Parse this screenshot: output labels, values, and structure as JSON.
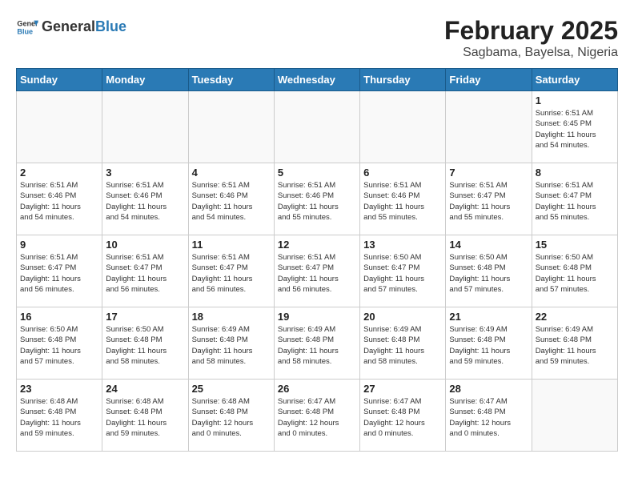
{
  "header": {
    "logo_general": "General",
    "logo_blue": "Blue",
    "title": "February 2025",
    "subtitle": "Sagbama, Bayelsa, Nigeria"
  },
  "calendar": {
    "days_of_week": [
      "Sunday",
      "Monday",
      "Tuesday",
      "Wednesday",
      "Thursday",
      "Friday",
      "Saturday"
    ],
    "weeks": [
      [
        {
          "day": "",
          "info": ""
        },
        {
          "day": "",
          "info": ""
        },
        {
          "day": "",
          "info": ""
        },
        {
          "day": "",
          "info": ""
        },
        {
          "day": "",
          "info": ""
        },
        {
          "day": "",
          "info": ""
        },
        {
          "day": "1",
          "info": "Sunrise: 6:51 AM\nSunset: 6:45 PM\nDaylight: 11 hours\nand 54 minutes."
        }
      ],
      [
        {
          "day": "2",
          "info": "Sunrise: 6:51 AM\nSunset: 6:46 PM\nDaylight: 11 hours\nand 54 minutes."
        },
        {
          "day": "3",
          "info": "Sunrise: 6:51 AM\nSunset: 6:46 PM\nDaylight: 11 hours\nand 54 minutes."
        },
        {
          "day": "4",
          "info": "Sunrise: 6:51 AM\nSunset: 6:46 PM\nDaylight: 11 hours\nand 54 minutes."
        },
        {
          "day": "5",
          "info": "Sunrise: 6:51 AM\nSunset: 6:46 PM\nDaylight: 11 hours\nand 55 minutes."
        },
        {
          "day": "6",
          "info": "Sunrise: 6:51 AM\nSunset: 6:46 PM\nDaylight: 11 hours\nand 55 minutes."
        },
        {
          "day": "7",
          "info": "Sunrise: 6:51 AM\nSunset: 6:47 PM\nDaylight: 11 hours\nand 55 minutes."
        },
        {
          "day": "8",
          "info": "Sunrise: 6:51 AM\nSunset: 6:47 PM\nDaylight: 11 hours\nand 55 minutes."
        }
      ],
      [
        {
          "day": "9",
          "info": "Sunrise: 6:51 AM\nSunset: 6:47 PM\nDaylight: 11 hours\nand 56 minutes."
        },
        {
          "day": "10",
          "info": "Sunrise: 6:51 AM\nSunset: 6:47 PM\nDaylight: 11 hours\nand 56 minutes."
        },
        {
          "day": "11",
          "info": "Sunrise: 6:51 AM\nSunset: 6:47 PM\nDaylight: 11 hours\nand 56 minutes."
        },
        {
          "day": "12",
          "info": "Sunrise: 6:51 AM\nSunset: 6:47 PM\nDaylight: 11 hours\nand 56 minutes."
        },
        {
          "day": "13",
          "info": "Sunrise: 6:50 AM\nSunset: 6:47 PM\nDaylight: 11 hours\nand 57 minutes."
        },
        {
          "day": "14",
          "info": "Sunrise: 6:50 AM\nSunset: 6:48 PM\nDaylight: 11 hours\nand 57 minutes."
        },
        {
          "day": "15",
          "info": "Sunrise: 6:50 AM\nSunset: 6:48 PM\nDaylight: 11 hours\nand 57 minutes."
        }
      ],
      [
        {
          "day": "16",
          "info": "Sunrise: 6:50 AM\nSunset: 6:48 PM\nDaylight: 11 hours\nand 57 minutes."
        },
        {
          "day": "17",
          "info": "Sunrise: 6:50 AM\nSunset: 6:48 PM\nDaylight: 11 hours\nand 58 minutes."
        },
        {
          "day": "18",
          "info": "Sunrise: 6:49 AM\nSunset: 6:48 PM\nDaylight: 11 hours\nand 58 minutes."
        },
        {
          "day": "19",
          "info": "Sunrise: 6:49 AM\nSunset: 6:48 PM\nDaylight: 11 hours\nand 58 minutes."
        },
        {
          "day": "20",
          "info": "Sunrise: 6:49 AM\nSunset: 6:48 PM\nDaylight: 11 hours\nand 58 minutes."
        },
        {
          "day": "21",
          "info": "Sunrise: 6:49 AM\nSunset: 6:48 PM\nDaylight: 11 hours\nand 59 minutes."
        },
        {
          "day": "22",
          "info": "Sunrise: 6:49 AM\nSunset: 6:48 PM\nDaylight: 11 hours\nand 59 minutes."
        }
      ],
      [
        {
          "day": "23",
          "info": "Sunrise: 6:48 AM\nSunset: 6:48 PM\nDaylight: 11 hours\nand 59 minutes."
        },
        {
          "day": "24",
          "info": "Sunrise: 6:48 AM\nSunset: 6:48 PM\nDaylight: 11 hours\nand 59 minutes."
        },
        {
          "day": "25",
          "info": "Sunrise: 6:48 AM\nSunset: 6:48 PM\nDaylight: 12 hours\nand 0 minutes."
        },
        {
          "day": "26",
          "info": "Sunrise: 6:47 AM\nSunset: 6:48 PM\nDaylight: 12 hours\nand 0 minutes."
        },
        {
          "day": "27",
          "info": "Sunrise: 6:47 AM\nSunset: 6:48 PM\nDaylight: 12 hours\nand 0 minutes."
        },
        {
          "day": "28",
          "info": "Sunrise: 6:47 AM\nSunset: 6:48 PM\nDaylight: 12 hours\nand 0 minutes."
        },
        {
          "day": "",
          "info": ""
        }
      ]
    ]
  }
}
